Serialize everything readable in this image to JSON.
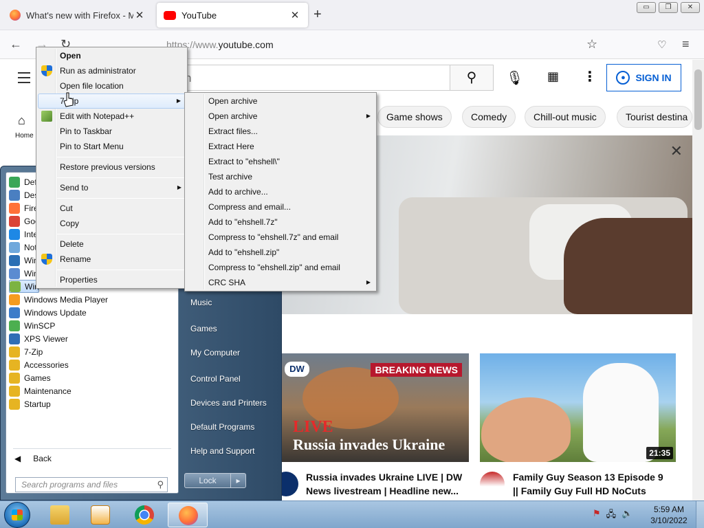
{
  "browser": {
    "tabs": [
      {
        "title": "What's new with Firefox - More",
        "close": "✕"
      },
      {
        "title": "YouTube",
        "close": "✕"
      }
    ],
    "new_tab": "+",
    "window_controls": {
      "minimize": "▭",
      "restore": "❐",
      "close": "✕"
    },
    "nav": {
      "back": "←",
      "forward": "→",
      "reload": "↻",
      "url_scheme": "https://www.",
      "url_host": "youtube.com",
      "bookmark": "☆",
      "pocket": "♡",
      "menu": "≡"
    }
  },
  "youtube": {
    "search_placeholder": "h",
    "search_icon": "⚲",
    "mic_icon": "🎙",
    "apps_icon": "▦",
    "more_icon": "⋮",
    "sign_in": "SIGN IN",
    "home_label": "Home",
    "chips": [
      "Game shows",
      "Comedy",
      "Chill-out music",
      "Tourist destina"
    ],
    "banner_close": "✕",
    "videos": [
      {
        "thumb_breaking": "BREAKING NEWS",
        "thumb_live": "LIVE",
        "thumb_headline": "Russia invades Ukraine",
        "thumb_logo": "DW",
        "title_line1": "Russia invades Ukraine LIVE | DW",
        "title_line2": "News livestream | Headline new..."
      },
      {
        "duration": "21:35",
        "title_line1": "Family Guy Season 13 Episode 9",
        "title_line2": "|| Family Guy Full HD NoCuts"
      }
    ]
  },
  "start_menu": {
    "programs": [
      {
        "label": "Def",
        "color": "#3aa757"
      },
      {
        "label": "Des",
        "color": "#4a7fc1"
      },
      {
        "label": "Fire",
        "color": "#ff7139"
      },
      {
        "label": "Goo",
        "color": "#db4437"
      },
      {
        "label": "Inte",
        "color": "#1e88e5"
      },
      {
        "label": "Not",
        "color": "#6fa8dc"
      },
      {
        "label": "Win",
        "color": "#2b6fb5"
      },
      {
        "label": "Win",
        "color": "#5b8bd1"
      },
      {
        "label": "Win",
        "color": "#7cb342"
      },
      {
        "label": "Windows Media Player",
        "color": "#f59b1f"
      },
      {
        "label": "Windows Update",
        "color": "#3d7cc9"
      },
      {
        "label": "WinSCP",
        "color": "#4caf50"
      },
      {
        "label": "XPS Viewer",
        "color": "#2f6eb5"
      },
      {
        "label": "7-Zip",
        "color": "#e6b422"
      },
      {
        "label": "Accessories",
        "color": "#e6b422"
      },
      {
        "label": "Games",
        "color": "#e6b422"
      },
      {
        "label": "Maintenance",
        "color": "#e6b422"
      },
      {
        "label": "Startup",
        "color": "#e6b422"
      }
    ],
    "back": "Back",
    "back_arrow": "◀",
    "search_placeholder": "Search programs and files",
    "right_items": [
      "Music",
      "Games",
      "My Computer",
      "Control Panel",
      "Devices and Printers",
      "Default Programs",
      "Help and Support"
    ],
    "lock": "Lock",
    "lock_arrow": "▸"
  },
  "context_menu": {
    "items": [
      "Open",
      "Run as administrator",
      "Open file location",
      "7-Zip",
      "Edit with Notepad++",
      "Pin to Taskbar",
      "Pin to Start Menu",
      "Restore previous versions",
      "Send to",
      "Cut",
      "Copy",
      "Delete",
      "Rename",
      "Properties"
    ],
    "submenu_arrow": "▶"
  },
  "zip_submenu": {
    "items": [
      "Open archive",
      "Open archive",
      "Extract files...",
      "Extract Here",
      "Extract to \"ehshell\\\"",
      "Test archive",
      "Add to archive...",
      "Compress and email...",
      "Add to \"ehshell.7z\"",
      "Compress to \"ehshell.7z\" and email",
      "Add to \"ehshell.zip\"",
      "Compress to \"ehshell.zip\" and email",
      "CRC SHA"
    ]
  },
  "taskbar": {
    "apps": [
      "Windows Explorer",
      "Windows Media Player",
      "Google Chrome",
      "Firefox"
    ],
    "tray_icons": [
      "⚑",
      "🖧",
      "🔈"
    ],
    "time": "5:59 AM",
    "date": "3/10/2022"
  }
}
